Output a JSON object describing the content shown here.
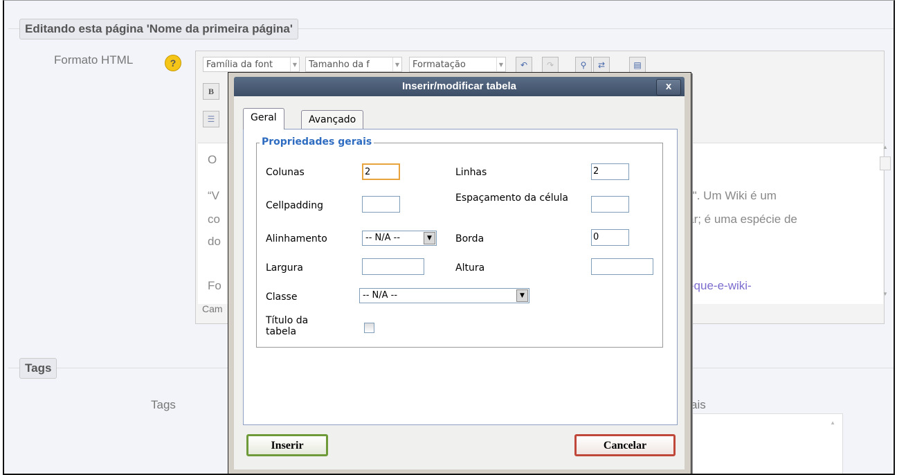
{
  "section_edit": {
    "legend": "Editando esta página 'Nome da primeira página'"
  },
  "field": {
    "label": "Formato HTML",
    "help_icon": "?"
  },
  "toolbar": {
    "font_family": "Família da font",
    "font_size": "Tamanho da f",
    "format": "Formatação",
    "bold": "B",
    "icons": [
      "undo-icon",
      "redo-icon",
      "find-icon",
      "replace-icon",
      "fullscreen-icon",
      "bold-icon",
      "list-icon"
    ]
  },
  "editor": {
    "line1": "O",
    "line2a": "“V",
    "line2b": "ido\". Um Wiki é um",
    "line3a": "co",
    "line3b": "orar; é uma espécie de",
    "line4a": "do",
    "line5a": "Fo",
    "line5b": "t/o-que-e-wiki-",
    "statusbar": "Cam"
  },
  "section_tags": {
    "legend": "Tags",
    "label": "Tags",
    "extra": "ais"
  },
  "dialog": {
    "title": "Inserir/modificar tabela",
    "close": "x",
    "tabs": [
      "Geral",
      "Avançado"
    ],
    "legend": "Propriedades gerais",
    "labels": {
      "colunas": "Colunas",
      "linhas": "Linhas",
      "cellpadding": "Cellpadding",
      "espacamento": "Espaçamento da célula",
      "alinhamento": "Alinhamento",
      "borda": "Borda",
      "largura": "Largura",
      "altura": "Altura",
      "classe": "Classe",
      "titulo": "Título da tabela"
    },
    "values": {
      "colunas": "2",
      "linhas": "2",
      "cellpadding": "",
      "espacamento": "",
      "alinhamento": "-- N/A --",
      "borda": "0",
      "largura": "",
      "altura": "",
      "classe": "-- N/A --",
      "titulo_checked": false
    },
    "buttons": {
      "insert": "Inserir",
      "cancel": "Cancelar"
    }
  },
  "colors": {
    "accent": "#2d6cc0",
    "insert_border": "#6f9a3a",
    "cancel_border": "#c0483a",
    "title_bar": "#4a5b74"
  }
}
